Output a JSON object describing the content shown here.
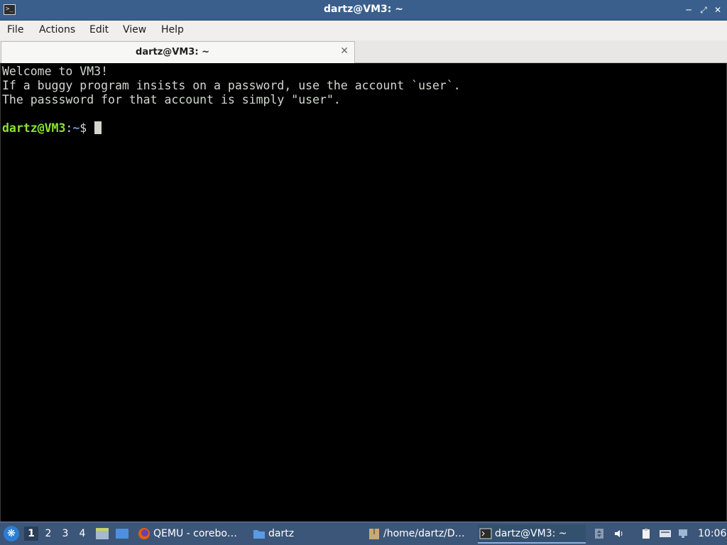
{
  "window": {
    "title": "dartz@VM3: ~",
    "min_icon": "minimize-icon",
    "max_icon": "maximize-icon",
    "close_icon": "close-icon"
  },
  "menubar": {
    "items": [
      "File",
      "Actions",
      "Edit",
      "View",
      "Help"
    ]
  },
  "tabs": [
    {
      "label": "dartz@VM3: ~",
      "close_glyph": "✕"
    }
  ],
  "terminal": {
    "lines": [
      "Welcome to VM3!",
      "If a buggy program insists on a password, use the account `user`.",
      "The passsword for that account is simply \"user\".",
      ""
    ],
    "prompt": {
      "user_host": "dartz@VM3",
      "separator": ":",
      "path": "~",
      "symbol": "$ "
    }
  },
  "taskbar": {
    "desktops": [
      "1",
      "2",
      "3",
      "4"
    ],
    "active_desktop": "1",
    "tasks": [
      {
        "label": "QEMU - corebo…",
        "icon": "firefox-icon"
      },
      {
        "label": "dartz",
        "icon": "folder-icon"
      },
      {
        "label": "/home/dartz/D…",
        "icon": "archive-icon"
      },
      {
        "label": "dartz@VM3: ~",
        "icon": "terminal-icon",
        "active": true
      }
    ],
    "clock": "10:06",
    "colors": {
      "taskbar_bg": "#3c5679",
      "titlebar_bg": "#3a5f8c",
      "prompt_user": "#8ae234",
      "prompt_path": "#729fcf"
    }
  }
}
